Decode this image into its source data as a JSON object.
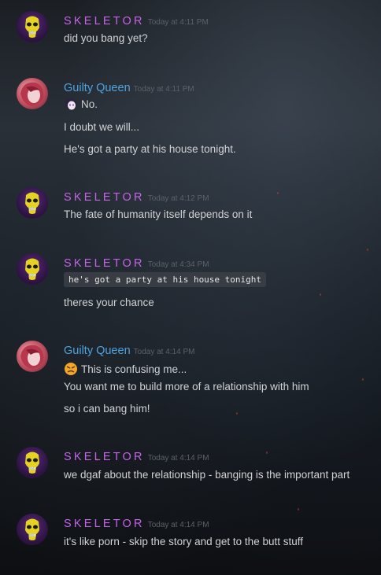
{
  "colors": {
    "skeletor": "#c364e6",
    "guilty_queen": "#4fa3df",
    "timestamp": "#5d6166",
    "text": "#d0d2d4"
  },
  "messages": [
    {
      "author": "SKELETOR",
      "timestamp": "Today at 4:11 PM",
      "lines": [
        "did you bang yet?"
      ]
    },
    {
      "author": "Guilty Queen",
      "timestamp": "Today at 4:11 PM",
      "lines": [
        "No.",
        "I doubt we will...",
        "He's got a party at his house tonight."
      ]
    },
    {
      "author": "SKELETOR",
      "timestamp": "Today at 4:12 PM",
      "lines": [
        "The fate of humanity itself depends on it"
      ]
    },
    {
      "author": "SKELETOR",
      "timestamp": "Today at 4:34 PM",
      "lines": [
        "he's got a party at his house tonight",
        "theres your chance"
      ]
    },
    {
      "author": "Guilty Queen",
      "timestamp": "Today at 4:14 PM",
      "lines": [
        "This is confusing me...",
        "You want me to build more of a relationship with him",
        "so i can bang him!"
      ]
    },
    {
      "author": "SKELETOR",
      "timestamp": "Today at 4:14 PM",
      "lines": [
        "we dgaf about the relationship - banging is the important part"
      ]
    },
    {
      "author": "SKELETOR",
      "timestamp": "Today at 4:14 PM",
      "lines": [
        "it's like porn - skip the story and get to the butt stuff"
      ]
    }
  ]
}
